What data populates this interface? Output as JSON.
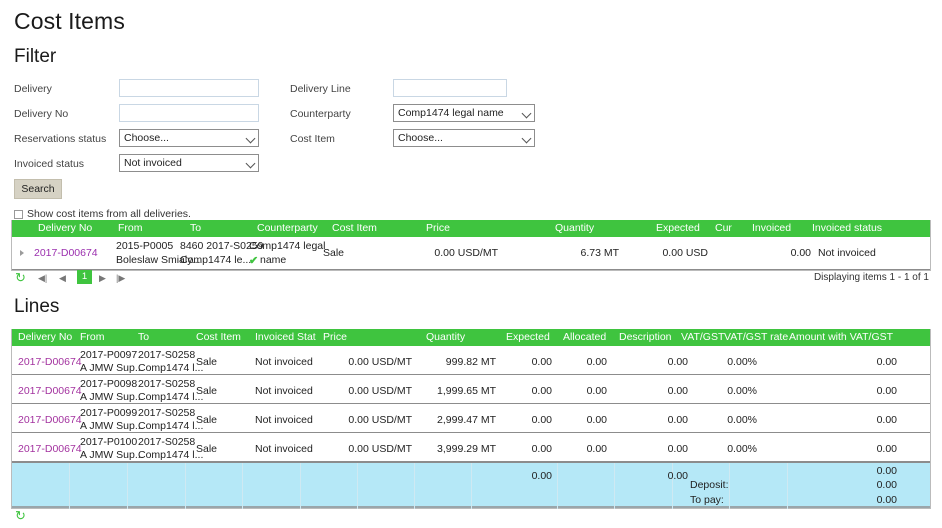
{
  "page": {
    "title": "Cost Items",
    "filter_heading": "Filter",
    "lines_heading": "Lines"
  },
  "filter": {
    "fields": [
      {
        "label": "Delivery",
        "type": "text",
        "value": "",
        "placeholder": ""
      },
      {
        "label": "Delivery No",
        "type": "text",
        "value": "",
        "placeholder": ""
      },
      {
        "label": "Reservations status",
        "type": "select",
        "value": "Choose..."
      },
      {
        "label": "Invoiced status",
        "type": "select",
        "value": "Not invoiced"
      },
      {
        "label": "Delivery Line",
        "type": "text",
        "value": "",
        "placeholder": ""
      },
      {
        "label": "Counterparty",
        "type": "select",
        "value": "Comp1474 legal name"
      },
      {
        "label": "Cost Item",
        "type": "select",
        "value": "Choose..."
      }
    ],
    "search_label": "Search"
  },
  "options": {
    "show_all_deliveries_label": "Show cost items from all deliveries.",
    "show_all_deliveries_checked": false
  },
  "cost_items_grid": {
    "columns": [
      "Delivery No",
      "From",
      "To",
      "Counterparty",
      "Cost Item",
      "Price",
      "Quantity",
      "Expected",
      "Cur",
      "Invoiced",
      "Invoiced status"
    ],
    "rows": [
      {
        "delivery_no": "2017-D00674",
        "from_line1": "2015-P0005",
        "from_line2": "Boleslaw Smialy...",
        "to_line1": "8460 2017-S0259",
        "to_line2": "Comp1474 le...",
        "counterparty_line1": "Comp1474 legal",
        "counterparty_line2": "name",
        "counterparty_verified": true,
        "cost_item": "Sale",
        "price": "0.00 USD/MT",
        "quantity": "6.73 MT",
        "expected": "0.00 USD",
        "cur": "",
        "invoiced": "0.00",
        "invoiced_status": "Not invoiced"
      }
    ],
    "pager": {
      "current_page": "1",
      "first_icon": "first-page-icon",
      "prev_icon": "previous-page-icon",
      "next_icon": "next-page-icon",
      "last_icon": "last-page-icon",
      "refresh_icon": "refresh-icon",
      "display_text": "Displaying items 1 - 1 of 1"
    }
  },
  "lines_grid": {
    "columns": [
      "Delivery No",
      "From",
      "To",
      "Cost Item",
      "Invoiced Stat",
      "Price",
      "Quantity",
      "Expected",
      "Allocated",
      "Description",
      "VAT/GST",
      "VAT/GST rate",
      "Amount with VAT/GST"
    ],
    "rows": [
      {
        "delivery_no": "2017-D00674",
        "from_line1": "2017-P0097",
        "from_line2": "A JMW Sup...",
        "to_line1": "2017-S0258",
        "to_line2": "Comp1474 l...",
        "cost_item": "Sale",
        "invoiced_status": "Not invoiced",
        "price": "0.00 USD/MT",
        "quantity": "999.82 MT",
        "expected": "0.00",
        "allocated": "0.00",
        "description": "",
        "vat_gst": "0.00",
        "vat_gst_rate": "0.00%",
        "amount_with_vat": "0.00"
      },
      {
        "delivery_no": "2017-D00674",
        "from_line1": "2017-P0098",
        "from_line2": "A JMW Sup...",
        "to_line1": "2017-S0258",
        "to_line2": "Comp1474 l...",
        "cost_item": "Sale",
        "invoiced_status": "Not invoiced",
        "price": "0.00 USD/MT",
        "quantity": "1,999.65 MT",
        "expected": "0.00",
        "allocated": "0.00",
        "description": "",
        "vat_gst": "0.00",
        "vat_gst_rate": "0.00%",
        "amount_with_vat": "0.00"
      },
      {
        "delivery_no": "2017-D00674",
        "from_line1": "2017-P0099",
        "from_line2": "A JMW Sup...",
        "to_line1": "2017-S0258",
        "to_line2": "Comp1474 l...",
        "cost_item": "Sale",
        "invoiced_status": "Not invoiced",
        "price": "0.00 USD/MT",
        "quantity": "2,999.47 MT",
        "expected": "0.00",
        "allocated": "0.00",
        "description": "",
        "vat_gst": "0.00",
        "vat_gst_rate": "0.00%",
        "amount_with_vat": "0.00"
      },
      {
        "delivery_no": "2017-D00674",
        "from_line1": "2017-P0100",
        "from_line2": "A JMW Sup...",
        "to_line1": "2017-S0258",
        "to_line2": "Comp1474 l...",
        "cost_item": "Sale",
        "invoiced_status": "Not invoiced",
        "price": "0.00 USD/MT",
        "quantity": "3,999.29 MT",
        "expected": "0.00",
        "allocated": "0.00",
        "description": "",
        "vat_gst": "0.00",
        "vat_gst_rate": "0.00%",
        "amount_with_vat": "0.00"
      }
    ],
    "summary": {
      "expected_total": "0.00",
      "vat_gst_total": "0.00",
      "amount_total": "0.00",
      "deposit_label": "Deposit:",
      "deposit_value": "0.00",
      "to_pay_label": "To pay:",
      "to_pay_value": "0.00"
    },
    "footer_refresh_icon": "refresh-icon"
  },
  "colors": {
    "grid_header_green": "#3fc43f",
    "link_purple": "#9b2fae",
    "summary_blue": "#b5e8f7",
    "button_gray": "#d6d2c4"
  }
}
